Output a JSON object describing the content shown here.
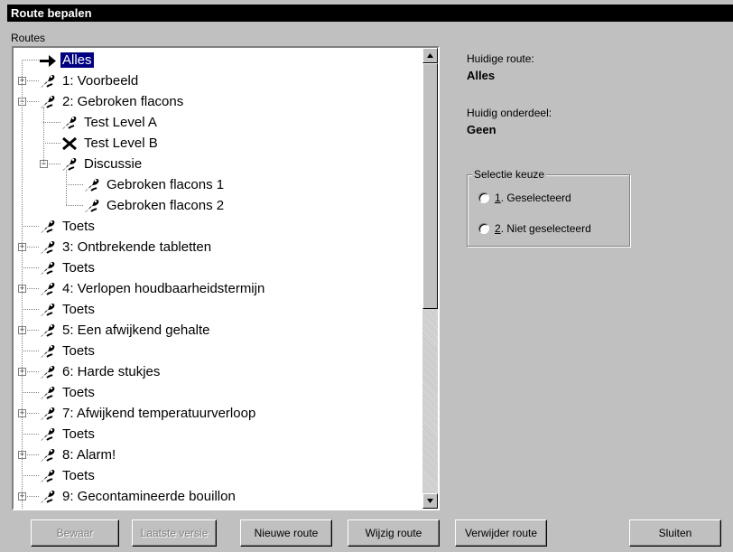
{
  "window": {
    "title": "Route bepalen"
  },
  "tree": {
    "header": "Routes",
    "nodes": [
      {
        "label": "Alles",
        "level": 0,
        "icon": "arrow-right-icon",
        "expander": "",
        "selected": true
      },
      {
        "label": "1: Voorbeeld",
        "level": 0,
        "icon": "route-icon",
        "expander": "+"
      },
      {
        "label": "2: Gebroken flacons",
        "level": 0,
        "icon": "route-icon",
        "expander": "-"
      },
      {
        "label": "Test Level A",
        "level": 1,
        "icon": "route-icon",
        "expander": ""
      },
      {
        "label": "Test Level B",
        "level": 1,
        "icon": "cross-icon",
        "expander": ""
      },
      {
        "label": "Discussie",
        "level": 1,
        "icon": "route-icon",
        "expander": "-"
      },
      {
        "label": "Gebroken flacons 1",
        "level": 2,
        "icon": "route-icon",
        "expander": ""
      },
      {
        "label": "Gebroken flacons 2",
        "level": 2,
        "icon": "route-icon",
        "expander": ""
      },
      {
        "label": "Toets",
        "level": 0,
        "icon": "route-icon",
        "expander": ""
      },
      {
        "label": "3: Ontbrekende tabletten",
        "level": 0,
        "icon": "route-icon",
        "expander": "+"
      },
      {
        "label": "Toets",
        "level": 0,
        "icon": "route-icon",
        "expander": ""
      },
      {
        "label": "4: Verlopen houdbaarheidstermijn",
        "level": 0,
        "icon": "route-icon",
        "expander": "+"
      },
      {
        "label": "Toets",
        "level": 0,
        "icon": "route-icon",
        "expander": ""
      },
      {
        "label": "5: Een afwijkend gehalte",
        "level": 0,
        "icon": "route-icon",
        "expander": "+"
      },
      {
        "label": "Toets",
        "level": 0,
        "icon": "route-icon",
        "expander": ""
      },
      {
        "label": "6: Harde stukjes",
        "level": 0,
        "icon": "route-icon",
        "expander": "+"
      },
      {
        "label": "Toets",
        "level": 0,
        "icon": "route-icon",
        "expander": ""
      },
      {
        "label": "7: Afwijkend temperatuurverloop",
        "level": 0,
        "icon": "route-icon",
        "expander": "+"
      },
      {
        "label": "Toets",
        "level": 0,
        "icon": "route-icon",
        "expander": ""
      },
      {
        "label": "8: Alarm!",
        "level": 0,
        "icon": "route-icon",
        "expander": "+"
      },
      {
        "label": "Toets",
        "level": 0,
        "icon": "route-icon",
        "expander": ""
      },
      {
        "label": "9: Gecontamineerde bouillon",
        "level": 0,
        "icon": "route-icon",
        "expander": "+"
      }
    ],
    "scroll_position": 0.0
  },
  "info": {
    "current_route_label": "Huidige route:",
    "current_route_value": "Alles",
    "current_part_label": "Huidig onderdeel:",
    "current_part_value": "Geen"
  },
  "selection": {
    "title": "Selectie keuze",
    "options": [
      {
        "accel": "1",
        "rest": ". Geselecteerd"
      },
      {
        "accel": "2",
        "rest": ". Niet geselecteerd"
      }
    ]
  },
  "buttons": {
    "save": "Bewaar",
    "latest": "Laatste versie",
    "new_route": "Nieuwe route",
    "edit_route": "Wijzig route",
    "delete_route": "Verwijder route",
    "close": "Sluiten"
  },
  "colors": {
    "selection": "#000080",
    "face": "#c0c0c0",
    "titlebar": "#000000"
  }
}
